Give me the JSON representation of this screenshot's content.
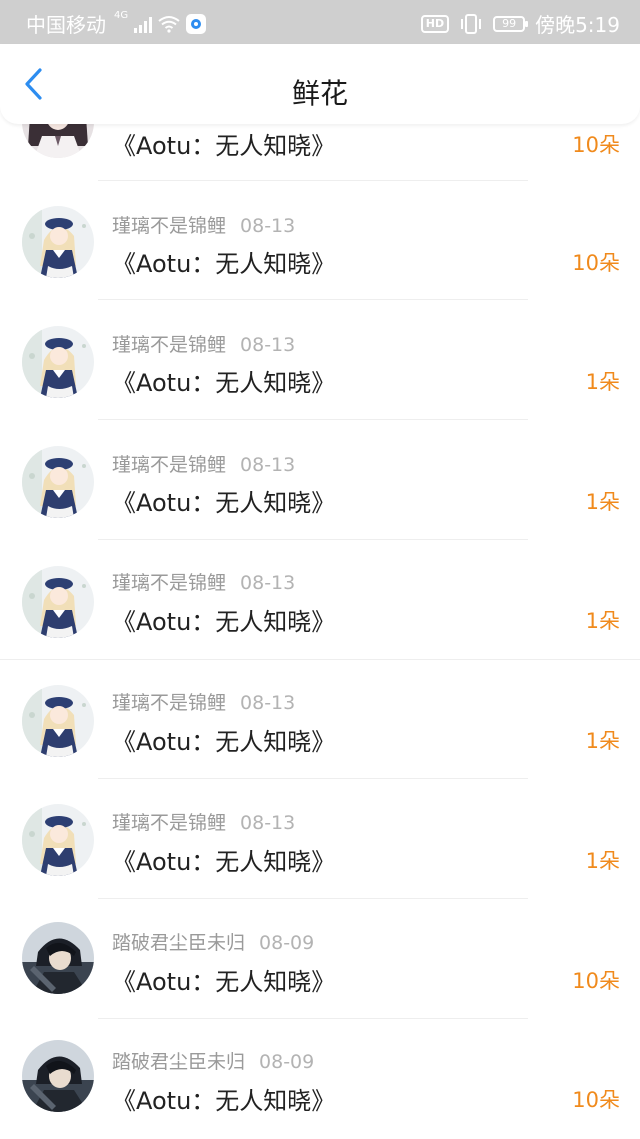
{
  "status_bar": {
    "carrier": "中国移动",
    "network": "4G",
    "hd": "HD",
    "battery": "99",
    "time": "傍晚5:19"
  },
  "header": {
    "title": "鲜花",
    "back_icon": "chevron-left-icon"
  },
  "colors": {
    "back_icon": "#2d8df0",
    "flower_count": "#f08a1c",
    "username": "#9a9a9a",
    "title": "#222222"
  },
  "items": [
    {
      "user": "",
      "date": "",
      "title": "《Aotu：无人知晓》",
      "count": "10朵",
      "avatar": "dark-hair-girl"
    },
    {
      "user": "瑾璃不是锦鲤",
      "date": "08-13",
      "title": "《Aotu：无人知晓》",
      "count": "10朵",
      "avatar": "sailor-girl"
    },
    {
      "user": "瑾璃不是锦鲤",
      "date": "08-13",
      "title": "《Aotu：无人知晓》",
      "count": "1朵",
      "avatar": "sailor-girl"
    },
    {
      "user": "瑾璃不是锦鲤",
      "date": "08-13",
      "title": "《Aotu：无人知晓》",
      "count": "1朵",
      "avatar": "sailor-girl"
    },
    {
      "user": "瑾璃不是锦鲤",
      "date": "08-13",
      "title": "《Aotu：无人知晓》",
      "count": "1朵",
      "avatar": "sailor-girl"
    },
    {
      "user": "瑾璃不是锦鲤",
      "date": "08-13",
      "title": "《Aotu：无人知晓》",
      "count": "1朵",
      "avatar": "sailor-girl"
    },
    {
      "user": "瑾璃不是锦鲤",
      "date": "08-13",
      "title": "《Aotu：无人知晓》",
      "count": "1朵",
      "avatar": "sailor-girl"
    },
    {
      "user": "踏破君尘臣未归",
      "date": "08-09",
      "title": "《Aotu：无人知晓》",
      "count": "10朵",
      "avatar": "dark-boy"
    },
    {
      "user": "踏破君尘臣未归",
      "date": "08-09",
      "title": "《Aotu：无人知晓》",
      "count": "10朵",
      "avatar": "dark-boy"
    }
  ]
}
